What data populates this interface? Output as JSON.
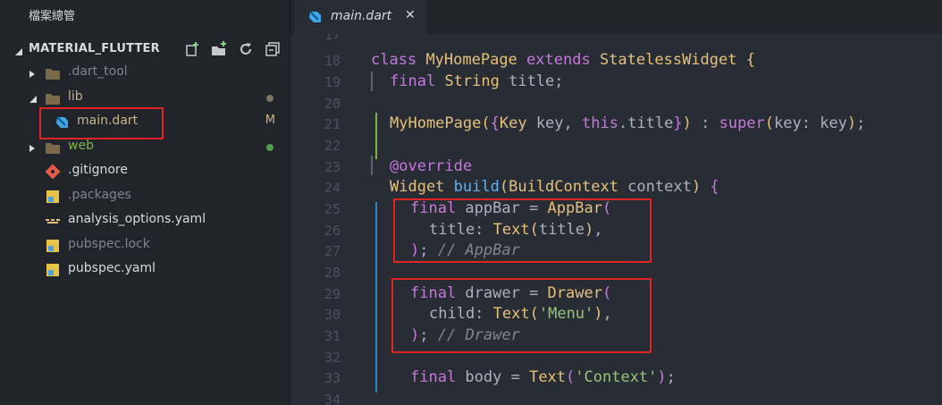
{
  "sidebar": {
    "title": "檔案總管",
    "project_name": "MATERIAL_FLUTTER",
    "actions": [
      "new-file-icon",
      "new-folder-icon",
      "refresh-icon",
      "collapse-all-icon"
    ],
    "items": [
      {
        "label": ".dart_tool",
        "kind": "folder",
        "state": "collapsed"
      },
      {
        "label": "lib",
        "kind": "folder",
        "state": "expanded"
      },
      {
        "label": "main.dart",
        "kind": "dart-file",
        "badge": "M"
      },
      {
        "label": "web",
        "kind": "folder",
        "state": "collapsed"
      },
      {
        "label": ".gitignore",
        "kind": "git-file"
      },
      {
        "label": ".packages",
        "kind": "file"
      },
      {
        "label": "analysis_options.yaml",
        "kind": "yaml-file"
      },
      {
        "label": "pubspec.lock",
        "kind": "file"
      },
      {
        "label": "pubspec.yaml",
        "kind": "file"
      }
    ],
    "colors": {
      "modified_dot": "#7f7560",
      "untracked_dot": "#4f9e4f",
      "highlight": "#e02424"
    }
  },
  "tabs": [
    {
      "label": "main.dart",
      "close": "✕",
      "active": true
    }
  ],
  "editor": {
    "line_numbers": [
      "17",
      "18",
      "19",
      "20",
      "21",
      "22",
      "23",
      "24",
      "25",
      "26",
      "27",
      "28",
      "29",
      "30",
      "31",
      "32",
      "33",
      "34"
    ]
  }
}
